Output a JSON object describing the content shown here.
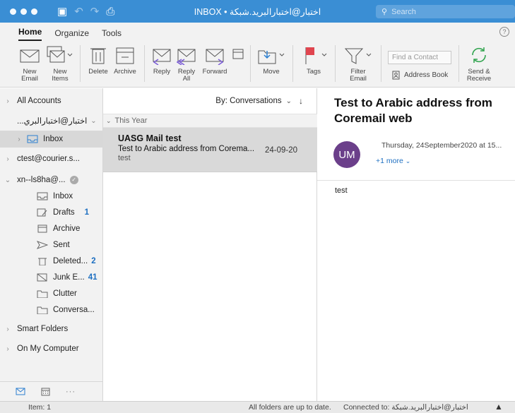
{
  "window": {
    "title": "INBOX • اختبار@اختبارالبريد.شبكة",
    "search_placeholder": "Search"
  },
  "ribbon_tabs": [
    {
      "label": "Home",
      "active": true
    },
    {
      "label": "Organize",
      "active": false
    },
    {
      "label": "Tools",
      "active": false
    }
  ],
  "ribbon": {
    "new_email": "New\nEmail",
    "new_items": "New\nItems",
    "delete": "Delete",
    "archive": "Archive",
    "reply": "Reply",
    "reply_all": "Reply\nAll",
    "forward": "Forward",
    "move": "Move",
    "tags": "Tags",
    "filter_email": "Filter\nEmail",
    "find_contact_placeholder": "Find a Contact",
    "address_book": "Address Book",
    "send_receive": "Send &\nReceive"
  },
  "sidebar": {
    "all_accounts": "All Accounts",
    "account1": "اختبار@اختبارالبري...",
    "account1_inbox": "Inbox",
    "account2": "ctest@courier.s...",
    "account3": "xn--ls8ha@...",
    "folders": [
      {
        "label": "Inbox",
        "icon": "inbox-icon",
        "count": ""
      },
      {
        "label": "Drafts",
        "icon": "drafts-icon",
        "count": "1"
      },
      {
        "label": "Archive",
        "icon": "archive-icon",
        "count": ""
      },
      {
        "label": "Sent",
        "icon": "sent-icon",
        "count": ""
      },
      {
        "label": "Deleted...",
        "icon": "trash-icon",
        "count": "2"
      },
      {
        "label": "Junk E...",
        "icon": "junk-icon",
        "count": "41"
      },
      {
        "label": "Clutter",
        "icon": "folder-icon",
        "count": ""
      },
      {
        "label": "Conversa...",
        "icon": "folder-icon",
        "count": ""
      }
    ],
    "smart_folders": "Smart Folders",
    "on_my_computer": "On My Computer"
  },
  "message_list": {
    "sort_label": "By: Conversations",
    "group": "This Year",
    "messages": [
      {
        "from": "UASG Mail test",
        "subject": "Test to Arabic address from Corema...",
        "date": "24-09-20",
        "preview": "test"
      }
    ]
  },
  "reading": {
    "subject": "Test to Arabic address from Coremail web",
    "avatar_initials": "UM",
    "date": "Thursday, 24September2020 at 15...",
    "more": "+1 more",
    "body": "test"
  },
  "status": {
    "item": "Item: 1",
    "sync": "All folders are up to date.",
    "connected": "Connected to: اختبار@اختبارالبريد.شبكة"
  },
  "colors": {
    "titlebar": "#3a8ed4",
    "accent": "#1d6fc1",
    "avatar": "#6b3f8a",
    "tag_flag": "#e0454f"
  }
}
